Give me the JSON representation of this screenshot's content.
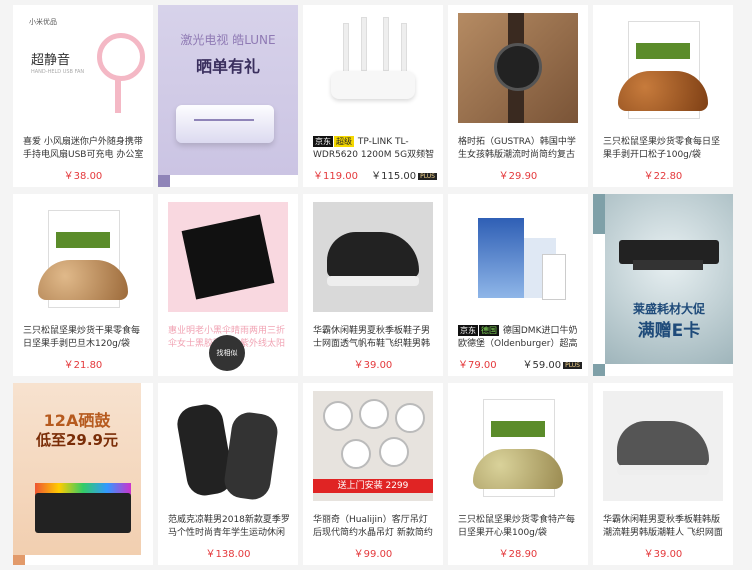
{
  "row1": [
    {
      "type": "product",
      "title": "喜爱 小风扇迷你户外随身携带手持电风扇USB可充电 办公室",
      "price": "￥38.00",
      "art": "fan",
      "art_text": "超静音",
      "art_sub": "HAND-HELD USB FAN",
      "logo": "小米优品"
    },
    {
      "type": "banner",
      "line1": "激光电视 皓LUNE",
      "line2": "晒单有礼"
    },
    {
      "type": "product",
      "title": "TP-LINK TL-WDR5620 1200M 5G双频智能无线路",
      "tags": [
        "京东",
        "超级"
      ],
      "price": "￥119.00",
      "plus_price": "￥115.00",
      "plus_label": "PLUS",
      "art": "router"
    },
    {
      "type": "product",
      "title": "格时拓（GUSTRA）韩国中学生女孩韩版潮流时尚简约复古风",
      "price": "￥29.90",
      "art": "watch"
    },
    {
      "type": "product",
      "title": "三只松鼠坚果炒货零食每日坚果手剥开口松子100g/袋",
      "price": "￥22.80",
      "art": "nut"
    }
  ],
  "row2": [
    {
      "type": "product",
      "title": "三只松鼠坚果炒货干果零食每日坚果手剥巴旦木120g/袋",
      "price": "￥21.80",
      "art": "nut"
    },
    {
      "type": "product",
      "title": "惠业明老小黑伞晴雨两用三折伞女士黑胶防晒防紫外线太阳伞",
      "price": "",
      "art": "umbrella",
      "overlay": "找相似",
      "faded": true
    },
    {
      "type": "product",
      "title": "华霸休闲鞋男夏秋季板鞋子男士网面透气帆布鞋飞织鞋男韩版潮",
      "price": "￥39.00",
      "art": "shoe"
    },
    {
      "type": "product",
      "title": "德国DMK进口牛奶 欧德堡（Oldenburger）超高温处",
      "tags": [
        "京东",
        "德国"
      ],
      "price": "￥79.00",
      "plus_price": "￥59.00",
      "plus_label": "PLUS",
      "art": "milk"
    },
    {
      "type": "banner",
      "line1": "莱盛耗材大促",
      "line2": "满赠E卡"
    }
  ],
  "row3": [
    {
      "type": "banner",
      "line1": "12A硒鼓",
      "line2": "低至29.9元"
    },
    {
      "type": "product",
      "title": "范威克凉鞋男2018新款夏季罗马个性时尚青年学生运动休闲韩",
      "price": "￥138.00",
      "art": "sandal"
    },
    {
      "type": "product",
      "title": "华丽奇（Hualijin）客厅吊灯 后现代简约水晶吊灯 新款简约吊灯",
      "price": "￥99.00",
      "art": "lamp",
      "art_text": "送上门安装",
      "art_price": "2299"
    },
    {
      "type": "product",
      "title": "三只松鼠坚果炒货零食特产每日坚果开心果100g/袋",
      "price": "￥28.90",
      "art": "pist"
    },
    {
      "type": "product",
      "title": "华霸休闲鞋男夏秋季板鞋韩版潮流鞋男韩版潮鞋人 飞织网面透",
      "price": "￥39.00",
      "art": "shoe-light"
    }
  ]
}
